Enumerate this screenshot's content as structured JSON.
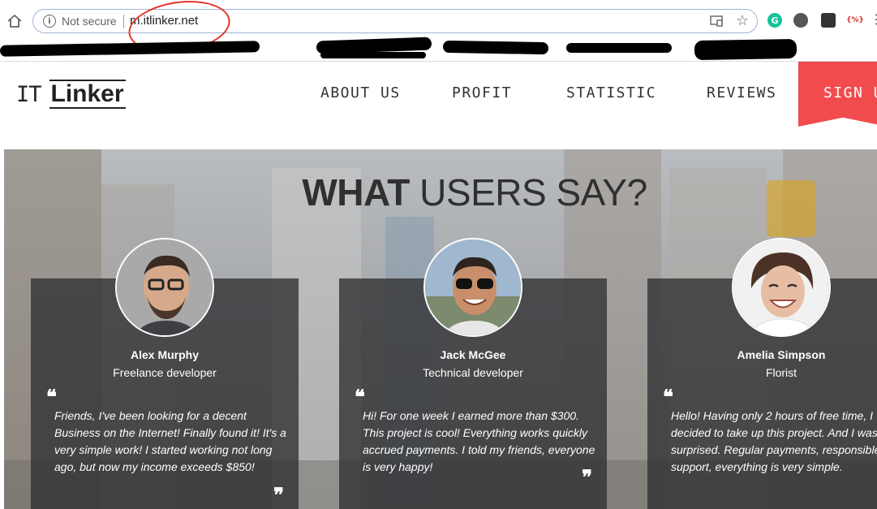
{
  "browser": {
    "security_label": "Not secure",
    "url": "m.itlinker.net",
    "info_glyph": "i",
    "extension_labels": [
      "G",
      "",
      "",
      "{%}"
    ]
  },
  "site": {
    "logo_prefix": "IT",
    "logo_name": "Linker",
    "nav": [
      "ABOUT US",
      "PROFIT",
      "STATISTIC",
      "REVIEWS"
    ],
    "signup_label": "SIGN U"
  },
  "reviews": {
    "title_bold": "WHAT",
    "title_rest": " USERS SAY?",
    "items": [
      {
        "name": "Alex Murphy",
        "role": "Freelance developer",
        "text": "Friends, I've been looking for a decent Business on the Internet! Finally found it! It's a very simple work! I started working not long ago, but now my income exceeds $850!"
      },
      {
        "name": "Jack McGee",
        "role": "Technical developer",
        "text": "Hi! For one week I earned more than $300. This project is cool! Everything works quickly accrued payments. I told my friends, everyone is very happy!"
      },
      {
        "name": "Amelia Simpson",
        "role": "Florist",
        "text": "Hello! Having only 2 hours of free time, I decided to take up this project. And I was surprised. Regular payments, responsible support, everything is very simple."
      }
    ]
  },
  "colors": {
    "accent": "#f24b4e",
    "card_bg": "#303032",
    "omnibox_border": "#9fb3d6"
  },
  "icons": {
    "home": "home-icon",
    "info": "info-icon",
    "cast": "cast-icon",
    "star": "star-icon",
    "quote_open": "quote-open-icon",
    "quote_close": "quote-close-icon"
  }
}
